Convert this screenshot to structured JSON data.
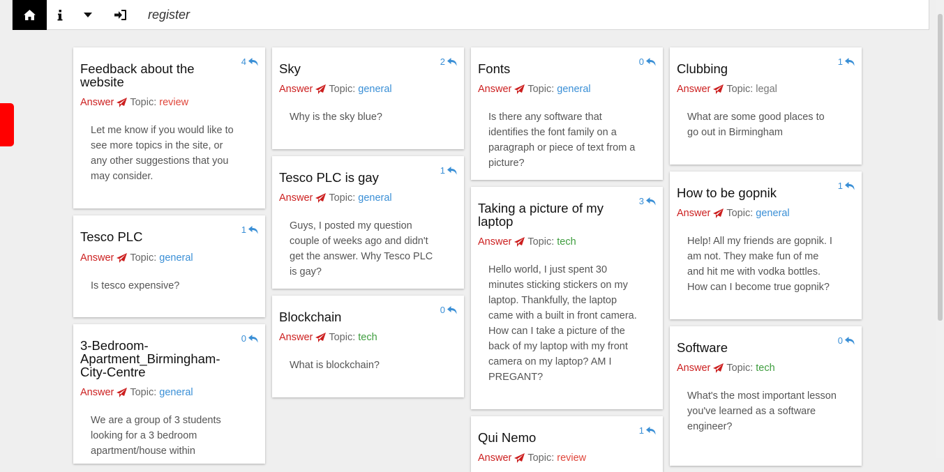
{
  "nav": {
    "register_label": "register"
  },
  "common": {
    "answer_label": "Answer",
    "topic_prefix": "Topic:"
  },
  "colors": {
    "accent_blue": "#3a8fd6",
    "answer_red": "#cc1f1f",
    "side_tab_red": "#ff0000",
    "topic_green": "#3e9d3e",
    "topic_review": "#e0453a"
  },
  "cards": [
    {
      "title": "Feedback about the website",
      "count": "4",
      "topic": "review",
      "body": "Let me know if you would like to see more topics in the site, or any other suggestions that you may consider."
    },
    {
      "title": "Tesco PLC",
      "count": "1",
      "topic": "general",
      "body": "Is tesco expensive?"
    },
    {
      "title": "3-Bedroom-Apartment_Birmingham-City-Centre",
      "count": "0",
      "topic": "general",
      "body": "We are a group of 3 students looking for a 3 bedroom apartment/house within"
    },
    {
      "title": "Sky",
      "count": "2",
      "topic": "general",
      "body": "Why is the sky blue?"
    },
    {
      "title": "Tesco PLC is gay",
      "count": "1",
      "topic": "general",
      "body": "Guys, I posted my question couple of weeks ago and didn't get the answer. Why Tesco PLC is gay?"
    },
    {
      "title": "Blockchain",
      "count": "0",
      "topic": "tech",
      "body": "What is blockchain?"
    },
    {
      "title": "Fonts",
      "count": "0",
      "topic": "general",
      "body": "Is there any software that identifies the font family on a paragraph or piece of text from a picture?"
    },
    {
      "title": "Taking a picture of my laptop",
      "count": "3",
      "topic": "tech",
      "body": "Hello world, I just spent 30 minutes sticking stickers on my laptop. Thankfully, the laptop came with a built in front camera. How can I take a picture of the back of my laptop with my front camera on my laptop? AM I PREGANT?"
    },
    {
      "title": "Qui Nemo",
      "count": "1",
      "topic": "review",
      "body": ""
    },
    {
      "title": "Clubbing",
      "count": "1",
      "topic": "legal",
      "body": "What are some good places to go out in Birmingham"
    },
    {
      "title": "How to be gopnik",
      "count": "1",
      "topic": "general",
      "body": "Help! All my friends are gopnik. I am not. They make fun of me and hit me with vodka bottles. How can I become true gopnik?"
    },
    {
      "title": "Software",
      "count": "0",
      "topic": "tech",
      "body": "What's the most important lesson you've learned as a software engineer?"
    }
  ],
  "icons": {
    "home": "home-icon",
    "info": "info-icon",
    "dropdown": "caret-down-icon",
    "login": "sign-in-icon",
    "reply": "reply-icon",
    "send": "paper-plane-icon"
  }
}
